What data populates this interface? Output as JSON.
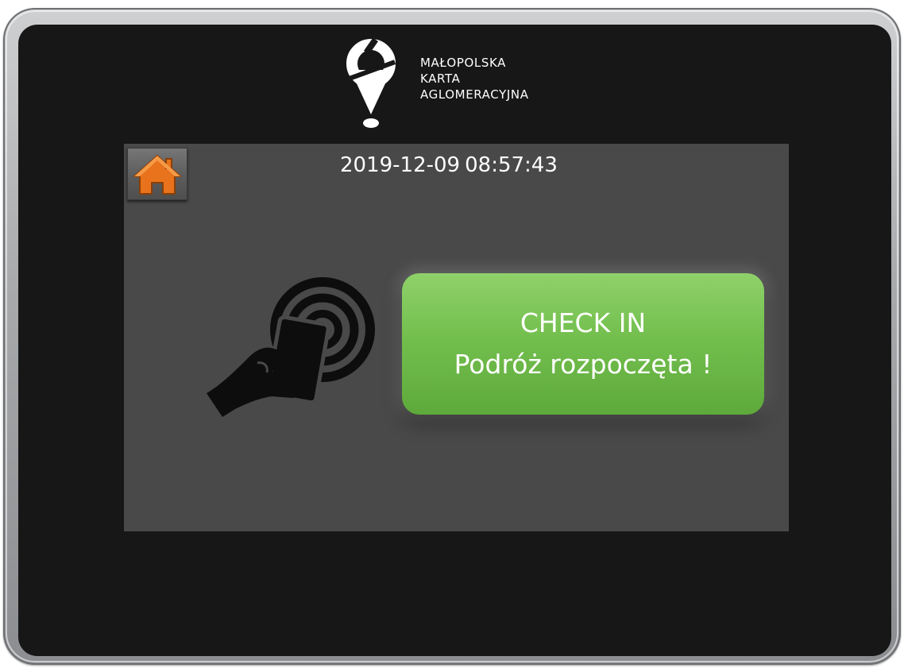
{
  "brand": {
    "line1": "MAŁOPOLSKA",
    "line2": "KARTA",
    "line3": "AGLOMERACYJNA"
  },
  "status_bar": {
    "date": "2019-12-09",
    "time": "08:57:43"
  },
  "home": {
    "icon": "home-icon",
    "color": "#e8731c"
  },
  "reader": {
    "icon": "contactless-card-icon"
  },
  "checkin": {
    "title": "CHECK IN",
    "message": "Podróż rozpoczęta !",
    "color": "#73bf4e"
  }
}
